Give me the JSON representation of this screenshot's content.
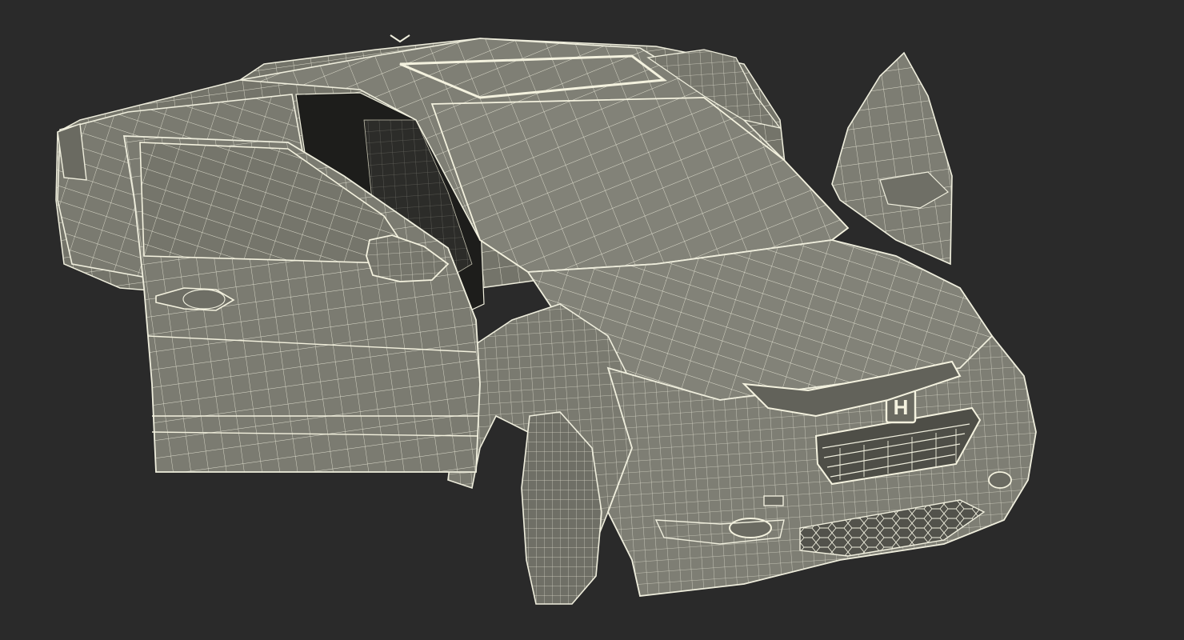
{
  "scene": {
    "subject": "car-wireframe-model",
    "brand_emblem": "H",
    "colors": {
      "background": "#2a2a2a",
      "body": "#7b7b70",
      "body_dark": "#5e5e55",
      "interior": "#1c1c1a",
      "wire": "#f2f0dc",
      "tire": "#6f6f66"
    }
  }
}
